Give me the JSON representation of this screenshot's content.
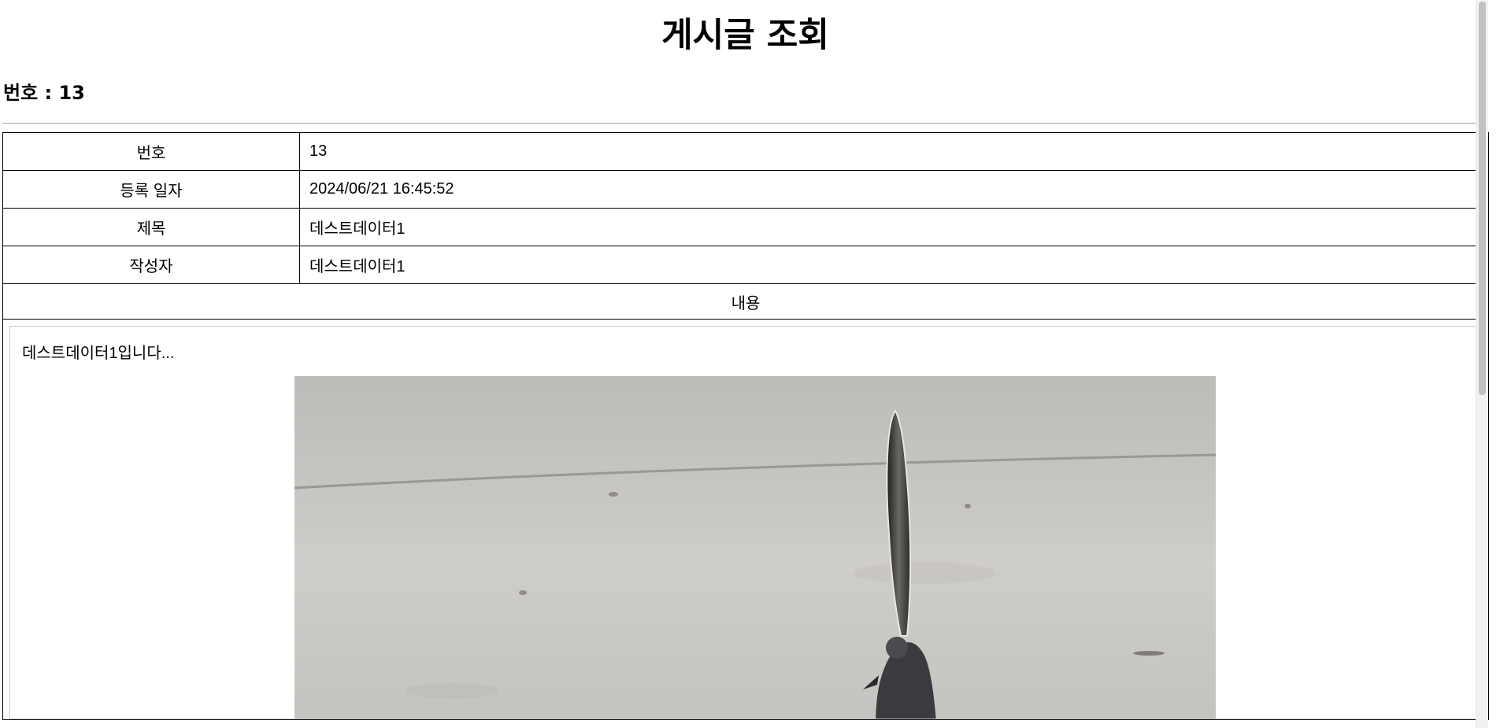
{
  "page": {
    "title": "게시글 조회",
    "post_number_label": "번호 : 13"
  },
  "table": {
    "rows": [
      {
        "label": "번호",
        "value": "13"
      },
      {
        "label": "등록 일자",
        "value": "2024/06/21 16:45:52"
      },
      {
        "label": "제목",
        "value": "데스트데이터1"
      },
      {
        "label": "작성자",
        "value": "데스트데이터1"
      }
    ],
    "content_header": "내용",
    "content_text": "데스트데이터1입니다..."
  },
  "image": {
    "description_icon": "photo-icon",
    "background_color": "#c9c8c5"
  }
}
